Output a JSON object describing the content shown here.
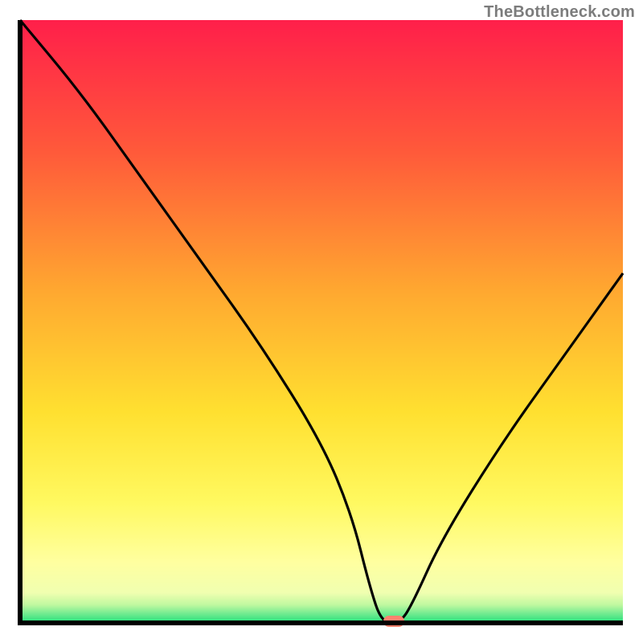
{
  "attribution": "TheBottleneck.com",
  "colors": {
    "top": "#ff1f4a",
    "mid_upper": "#ff9930",
    "mid": "#ffe030",
    "mid_lower": "#ffff80",
    "green": "#22e07a",
    "marker": "#ff836f",
    "line": "#000000",
    "axis": "#000000"
  },
  "chart_data": {
    "type": "line",
    "title": "",
    "xlabel": "",
    "ylabel": "",
    "xlim": [
      0,
      100
    ],
    "ylim": [
      0,
      100
    ],
    "x": [
      0,
      10,
      20,
      30,
      40,
      50,
      55,
      58,
      60,
      63,
      65,
      70,
      80,
      90,
      100
    ],
    "values": [
      100,
      88,
      74,
      60,
      46,
      30,
      18,
      6,
      0,
      0,
      3,
      14,
      30,
      44,
      58
    ],
    "marker_x": 62,
    "marker_y": 0,
    "gradient_bands": [
      {
        "pos": 0.0,
        "value": 100
      },
      {
        "pos": 0.4,
        "value": 60
      },
      {
        "pos": 0.68,
        "value": 32
      },
      {
        "pos": 0.82,
        "value": 18
      },
      {
        "pos": 0.94,
        "value": 6
      },
      {
        "pos": 0.985,
        "value": 1.5
      },
      {
        "pos": 1.0,
        "value": 0
      }
    ]
  }
}
